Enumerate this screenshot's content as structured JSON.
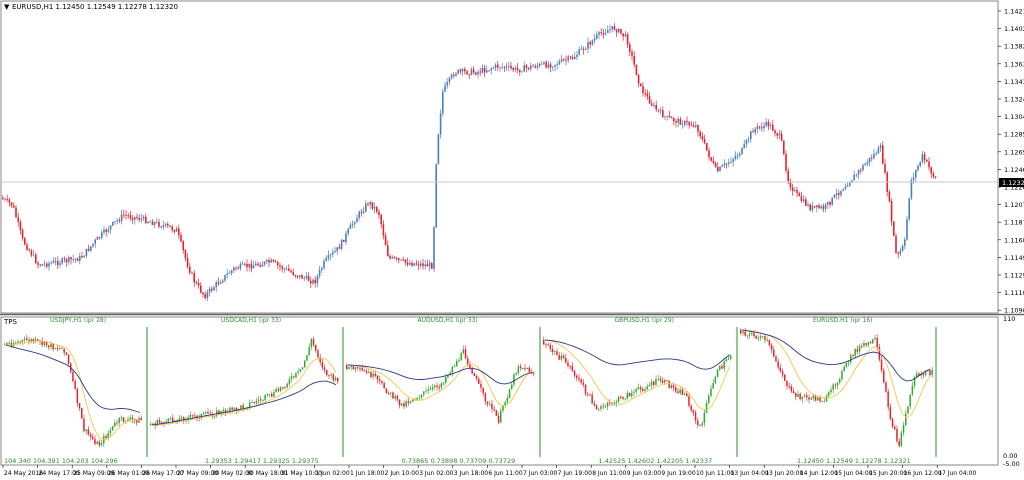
{
  "colors": {
    "bull": "#4a7ebf",
    "bear": "#e8202a",
    "grid": "#c8c8c8",
    "text": "#000000",
    "indicator_text": "#2e8b2e",
    "separator": "#2e8b2e",
    "ma_yellow": "#f2c84b",
    "ma_navy": "#2a3a8c",
    "bid_box": "#000000"
  },
  "main": {
    "title": "EURUSD,H1  1.12450 1.12549 1.12278 1.12320",
    "current_price": "1.12320",
    "price_labels": [
      "1.14210",
      "1.14020",
      "1.13825",
      "1.13630",
      "1.13435",
      "1.13240",
      "1.13045",
      "1.12850",
      "1.12655",
      "1.12460",
      "1.12265",
      "1.12070",
      "1.11875",
      "1.11685",
      "1.11490",
      "1.11295",
      "1.11100",
      "1.10905"
    ],
    "collapse_icon": "triangle-down-icon"
  },
  "sub": {
    "title": "TPS",
    "axis_labels": [
      "110",
      "0.00",
      "-5.00"
    ],
    "panels": [
      {
        "symbol": "USDJPY,H1 (ipr 28)",
        "values": "104.340  104.391  104.203  104.296"
      },
      {
        "symbol": "USDCAD,H1 (ipr 33)",
        "values": "1.29353  1.29417  1.29325  1.29375"
      },
      {
        "symbol": "AUDUSD,H1 (ipr 33)",
        "values": "0.73865  0.73898  0.73709  0.73729"
      },
      {
        "symbol": "GBPUSD,H1 (ipr 29)",
        "values": "1.42525  1.42602  1.42205  1.42337"
      },
      {
        "symbol": "EURUSD,H1 (ipr 16)",
        "values": "1.12450  1.12549  1.12278  1.12321"
      }
    ]
  },
  "time_labels": [
    "24 May 2016",
    "24 May 17:00",
    "25 May 09:00",
    "26 May 01:00",
    "26 May 17:00",
    "27 May 09:00",
    "30 May 02:00",
    "30 May 18:00",
    "31 May 10:00",
    "1 Jun 02:00",
    "1 Jun 18:00",
    "2 Jun 10:00",
    "3 Jun 02:00",
    "3 Jun 18:00",
    "6 Jun 11:00",
    "7 Jun 03:00",
    "7 Jun 19:00",
    "8 Jun 11:00",
    "9 Jun 03:00",
    "9 Jun 19:00",
    "10 Jun 11:00",
    "13 Jun 04:00",
    "13 Jun 20:00",
    "14 Jun 12:00",
    "15 Jun 04:00",
    "15 Jun 20:00",
    "16 Jun 12:00",
    "17 Jun 04:00"
  ]
}
